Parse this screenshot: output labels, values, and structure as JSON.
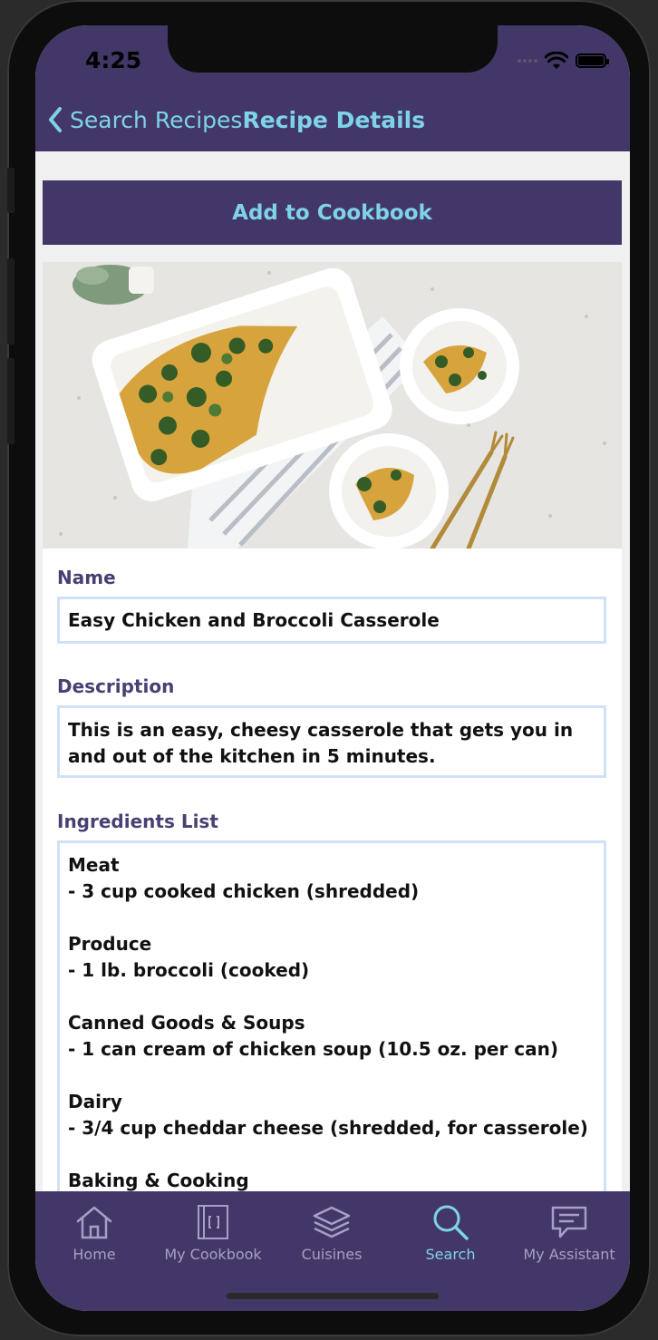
{
  "status_bar": {
    "time": "4:25"
  },
  "nav": {
    "back_label": "Search Recipes",
    "title": "Recipe Details"
  },
  "actions": {
    "add_to_cookbook": "Add to Cookbook"
  },
  "recipe": {
    "name_label": "Name",
    "name": "Easy Chicken and Broccoli Casserole",
    "description_label": "Description",
    "description": "This is an easy, cheesy casserole that gets you in and out of the kitchen in 5 minutes.",
    "ingredients_label": "Ingredients List",
    "ingredients": [
      {
        "category": "Meat",
        "item": "- 3 cup cooked chicken (shredded)"
      },
      {
        "category": "Produce",
        "item": "- 1 lb. broccoli (cooked)"
      },
      {
        "category": "Canned Goods & Soups",
        "item": "- 1 can cream of chicken soup (10.5 oz. per can)"
      },
      {
        "category": "Dairy",
        "item": "- 3/4 cup cheddar cheese (shredded, for casserole)"
      },
      {
        "category": "Baking & Cooking",
        "item": ""
      }
    ]
  },
  "tabs": [
    {
      "label": "Home",
      "icon": "home-icon"
    },
    {
      "label": "My Cookbook",
      "icon": "cookbook-icon"
    },
    {
      "label": "Cuisines",
      "icon": "layers-icon"
    },
    {
      "label": "Search",
      "icon": "search-icon"
    },
    {
      "label": "My Assistant",
      "icon": "chat-icon"
    }
  ],
  "colors": {
    "header": "#433768",
    "accent": "#7fd3e6",
    "tab_inactive": "#a79fc6",
    "label": "#4a3f73",
    "field_border": "#cfe2f5"
  }
}
